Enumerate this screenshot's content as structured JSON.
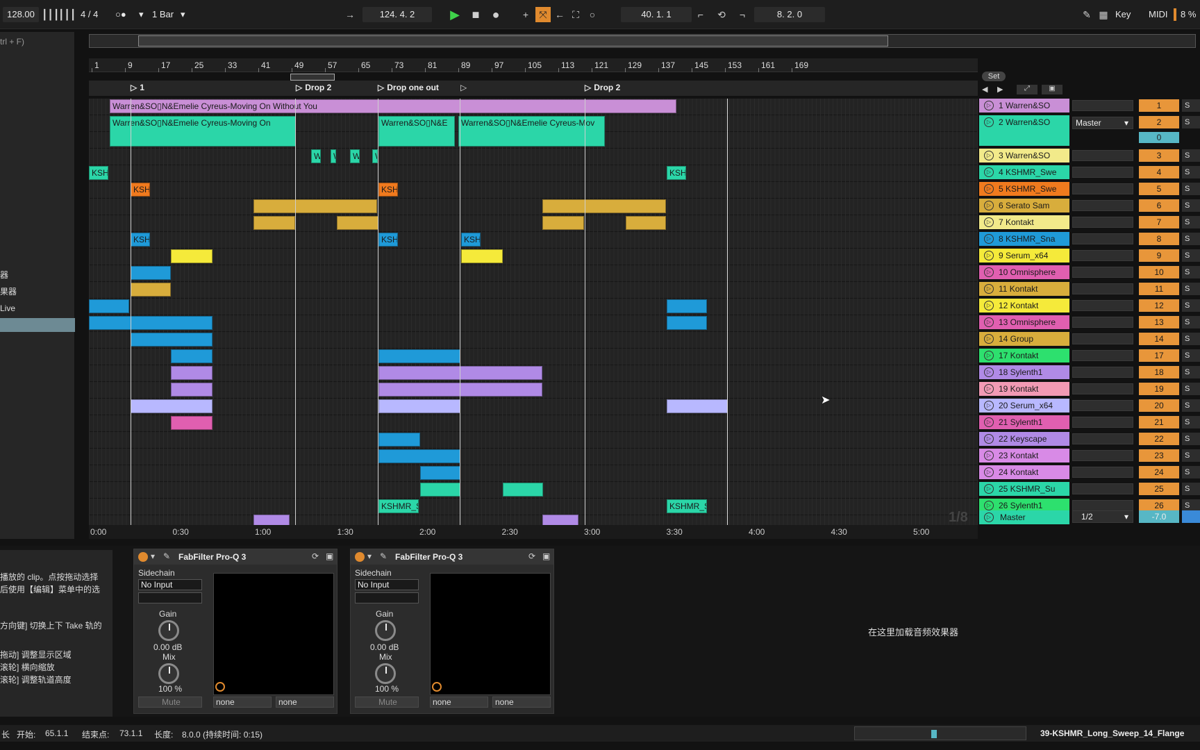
{
  "transport": {
    "tempo": "128.00",
    "signature": "4 / 4",
    "quantize": "1 Bar",
    "position": "124.  4.  2",
    "loop_start": "40.  1.  1",
    "loop_length": "8.  2.  0",
    "key_label": "Key",
    "midi_label": "MIDI",
    "cpu": "8 %"
  },
  "browser": {
    "search_hint": "trl + F)",
    "items": [
      "器",
      "果器",
      "Live"
    ]
  },
  "ruler": {
    "bars": [
      "1",
      "9",
      "17",
      "25",
      "33",
      "41",
      "49",
      "57",
      "65",
      "73",
      "81",
      "89",
      "97",
      "105",
      "113",
      "121",
      "129",
      "137",
      "145",
      "153",
      "161",
      "169"
    ]
  },
  "locators": [
    "1",
    "Drop 2",
    "Drop one out",
    "Drop 2"
  ],
  "set_label": "Set",
  "timeline": [
    "0:00",
    "0:30",
    "1:00",
    "1:30",
    "2:00",
    "2:30",
    "3:00",
    "3:30",
    "4:00",
    "4:30",
    "5:00"
  ],
  "zoom_hint": "1/8",
  "clips": {
    "vocal_long": "Warren&SO▯N&Emelie Cyreus-Moving On Without You",
    "vocal_a": "Warren&SO▯N&Emelie Cyreus-Moving On",
    "vocal_b": "Warren&SO▯N&E",
    "vocal_c": "Warren&SO▯N&Emelie Cyreus-Mov",
    "w": "W",
    "ksh": "KSH",
    "kshmr_s": "KSHMR_S"
  },
  "tracks": [
    {
      "name": "1 Warren&SO",
      "num": "1",
      "color": "#c98fd6"
    },
    {
      "name": "2 Warren&SO",
      "num": "2",
      "color": "#2bd6a8"
    },
    {
      "name": "3 Warren&SO",
      "num": "3",
      "color": "#f2ea8a"
    },
    {
      "name": "4 KSHMR_Swe",
      "num": "4",
      "color": "#2bd6a8"
    },
    {
      "name": "5 KSHMR_Swe",
      "num": "5",
      "color": "#f07a1e"
    },
    {
      "name": "6 Serato Sam",
      "num": "6",
      "color": "#d8ad3c"
    },
    {
      "name": "7 Kontakt",
      "num": "7",
      "color": "#f2ea8a"
    },
    {
      "name": "8 KSHMR_Sna",
      "num": "8",
      "color": "#1f9ad8"
    },
    {
      "name": "9 Serum_x64",
      "num": "9",
      "color": "#f5ea3a"
    },
    {
      "name": "10 Omnisphere",
      "num": "10",
      "color": "#e05fb0"
    },
    {
      "name": "11 Kontakt",
      "num": "11",
      "color": "#d8ad3c"
    },
    {
      "name": "12 Kontakt",
      "num": "12",
      "color": "#f5ea3a"
    },
    {
      "name": "13 Omnisphere",
      "num": "13",
      "color": "#e05fb0"
    },
    {
      "name": "14 Group",
      "num": "14",
      "color": "#d8ad3c"
    },
    {
      "name": "17 Kontakt",
      "num": "17",
      "color": "#2de06e"
    },
    {
      "name": "18 Sylenth1",
      "num": "18",
      "color": "#b08ae6"
    },
    {
      "name": "19 Kontakt",
      "num": "19",
      "color": "#f29ab4"
    },
    {
      "name": "20 Serum_x64",
      "num": "20",
      "color": "#b8b8ff"
    },
    {
      "name": "21 Sylenth1",
      "num": "21",
      "color": "#e05fb0"
    },
    {
      "name": "22 Keyscape",
      "num": "22",
      "color": "#b08ae6"
    },
    {
      "name": "23 Kontakt",
      "num": "23",
      "color": "#d88ae6"
    },
    {
      "name": "24 Kontakt",
      "num": "24",
      "color": "#d88ae6"
    },
    {
      "name": "25 KSHMR_Su",
      "num": "25",
      "color": "#2bd6a8"
    },
    {
      "name": "26 Sylenth1",
      "num": "26",
      "color": "#2de06e"
    }
  ],
  "master": {
    "name": "Master",
    "routing": "1/2",
    "volume": "-7.0",
    "output": "Master",
    "send_val": "0"
  },
  "devices": [
    {
      "title": "FabFilter Pro-Q 3",
      "sidechain": "Sidechain",
      "input": "No Input",
      "gain_label": "Gain",
      "gain": "0.00 dB",
      "mix_label": "Mix",
      "mix": "100 %",
      "mute": "Mute",
      "a": "none",
      "b": "none"
    },
    {
      "title": "FabFilter Pro-Q 3",
      "sidechain": "Sidechain",
      "input": "No Input",
      "gain_label": "Gain",
      "gain": "0.00 dB",
      "mix_label": "Mix",
      "mix": "100 %",
      "mute": "Mute",
      "a": "none",
      "b": "none"
    }
  ],
  "drop_message": "在这里加载音频效果器",
  "info_lines": [
    "播放的 clip。点按拖动选择",
    "后使用【编辑】菜单中的选",
    "方向键] 切换上下 Take 轨的",
    "拖动] 调整显示区域",
    "滚轮] 横向缩放",
    "滚轮] 调整轨道高度"
  ],
  "status": {
    "len_label": "长",
    "start_label": "开始:",
    "start": "65.1.1",
    "end_label": "结束点:",
    "end": "73.1.1",
    "length_label": "长度:",
    "length": "8.0.0 (持续时间: 0:15)",
    "file": "39-KSHMR_Long_Sweep_14_Flange"
  }
}
